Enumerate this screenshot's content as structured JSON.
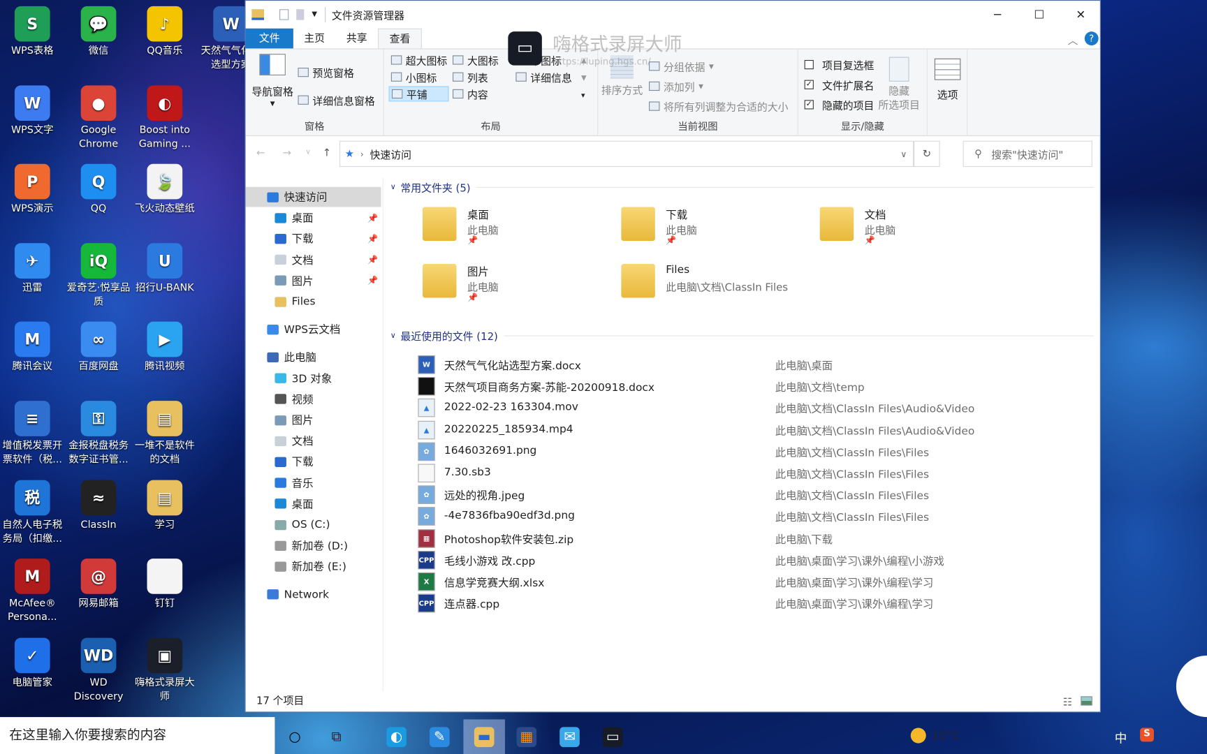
{
  "desktop": {
    "icons": [
      {
        "label": "WPS表格",
        "color": "#1e9e57",
        "glyph": "S"
      },
      {
        "label": "WPS文字",
        "color": "#3d7cf0",
        "glyph": "W"
      },
      {
        "label": "WPS演示",
        "color": "#f06a2f",
        "glyph": "P"
      },
      {
        "label": "迅雷",
        "color": "#2f8bf0",
        "glyph": "✈"
      },
      {
        "label": "腾讯会议",
        "color": "#2a7af0",
        "glyph": "M"
      },
      {
        "label": "增值税发票开票软件（税...",
        "color": "#2f6fd0",
        "glyph": "≡"
      },
      {
        "label": "自然人电子税务局（扣缴...",
        "color": "#1f74d8",
        "glyph": "税"
      },
      {
        "label": "McAfee® Persona...",
        "color": "#b01c1c",
        "glyph": "M"
      },
      {
        "label": "电脑管家",
        "color": "#1f6fe8",
        "glyph": "✓"
      },
      {
        "label": "微信",
        "color": "#2ab34a",
        "glyph": "💬"
      },
      {
        "label": "Google Chrome",
        "color": "#db4437",
        "glyph": "●"
      },
      {
        "label": "QQ",
        "color": "#1e8ef0",
        "glyph": "Q"
      },
      {
        "label": "爱奇艺·悦享品质",
        "color": "#15b83b",
        "glyph": "iQ"
      },
      {
        "label": "百度网盘",
        "color": "#3b8cf0",
        "glyph": "∞"
      },
      {
        "label": "金报税盘税务数字证书管...",
        "color": "#2a8ae0",
        "glyph": "⚿"
      },
      {
        "label": "ClassIn",
        "color": "#222222",
        "glyph": "≈"
      },
      {
        "label": "网易邮箱",
        "color": "#d23a3a",
        "glyph": "@"
      },
      {
        "label": "WD Discovery",
        "color": "#1a5fb0",
        "glyph": "WD"
      },
      {
        "label": "QQ音乐",
        "color": "#f4c400",
        "glyph": "♪"
      },
      {
        "label": "Boost into Gaming ...",
        "color": "#c01818",
        "glyph": "◐"
      },
      {
        "label": "飞火动态壁纸",
        "color": "#f3f3f3",
        "glyph": "🍃"
      },
      {
        "label": "招行U-BANK",
        "color": "#2a7ae0",
        "glyph": "U"
      },
      {
        "label": "腾讯视频",
        "color": "#2aa3f0",
        "glyph": "▶"
      },
      {
        "label": "一堆不是软件的文档",
        "color": "#e8c060",
        "glyph": "▤"
      },
      {
        "label": "学习",
        "color": "#e8c060",
        "glyph": "▤"
      },
      {
        "label": "钉钉",
        "color": "#f4f4f4",
        "glyph": " "
      },
      {
        "label": "嗨格式录屏大师",
        "color": "#1b1f2a",
        "glyph": "▣"
      },
      {
        "label": "天然气气化站选型方案",
        "color": "#2b5fb8",
        "glyph": "W"
      }
    ]
  },
  "watermark": {
    "title": "嗨格式录屏大师",
    "url": "https://luping.hgs.cn/"
  },
  "window": {
    "title": "文件资源管理器",
    "tabs": [
      "文件",
      "主页",
      "共享",
      "查看"
    ],
    "active_tab": "查看",
    "ribbon": {
      "pane": {
        "nav": "导航窗格",
        "preview": "预览窗格",
        "details": "详细信息窗格",
        "label": "窗格"
      },
      "layout": {
        "items": [
          "超大图标",
          "大图标",
          "中图标",
          "小图标",
          "列表",
          "详细信息",
          "平铺",
          "内容"
        ],
        "selected": "平铺",
        "label": "布局"
      },
      "view": {
        "sort": "排序方式",
        "group": "分组依据",
        "addcol": "添加列",
        "fit": "将所有列调整为合适的大小",
        "label": "当前视图"
      },
      "showhide": {
        "checkboxes": [
          {
            "label": "项目复选框",
            "checked": false
          },
          {
            "label": "文件扩展名",
            "checked": true
          },
          {
            "label": "隐藏的项目",
            "checked": true
          }
        ],
        "hide1": "隐藏",
        "hide2": "所选项目",
        "label": "显示/隐藏"
      },
      "options": "选项"
    },
    "address": {
      "path": "快速访问",
      "search_placeholder": "搜索\"快速访问\""
    },
    "nav": [
      {
        "label": "快速访问",
        "indent": 0,
        "color": "#2a7ae0",
        "selected": true
      },
      {
        "label": "桌面",
        "indent": 1,
        "color": "#1a8ad8",
        "pin": true
      },
      {
        "label": "下载",
        "indent": 1,
        "color": "#2a6ad0",
        "pin": true
      },
      {
        "label": "文档",
        "indent": 1,
        "color": "#c8d0da",
        "pin": true
      },
      {
        "label": "图片",
        "indent": 1,
        "color": "#7a9ab8",
        "pin": true
      },
      {
        "label": "Files",
        "indent": 1,
        "color": "#e8c060"
      },
      {
        "label": "WPS云文档",
        "indent": 0,
        "color": "#3a8ae8",
        "gap": true
      },
      {
        "label": "此电脑",
        "indent": 0,
        "color": "#3a6ab8",
        "gap": true
      },
      {
        "label": "3D 对象",
        "indent": 1,
        "color": "#3ab8e8"
      },
      {
        "label": "视频",
        "indent": 1,
        "color": "#555"
      },
      {
        "label": "图片",
        "indent": 1,
        "color": "#7a9ab8"
      },
      {
        "label": "文档",
        "indent": 1,
        "color": "#c8d0da"
      },
      {
        "label": "下载",
        "indent": 1,
        "color": "#2a6ad0"
      },
      {
        "label": "音乐",
        "indent": 1,
        "color": "#2a7ae0"
      },
      {
        "label": "桌面",
        "indent": 1,
        "color": "#1a8ad8"
      },
      {
        "label": "OS (C:)",
        "indent": 1,
        "color": "#8aa"
      },
      {
        "label": "新加卷 (D:)",
        "indent": 1,
        "color": "#999"
      },
      {
        "label": "新加卷 (E:)",
        "indent": 1,
        "color": "#999"
      },
      {
        "label": "Network",
        "indent": 0,
        "color": "#3a7ad8",
        "gap": true
      }
    ],
    "frequent": {
      "header": "常用文件夹 (5)",
      "items": [
        {
          "name": "桌面",
          "path": "此电脑",
          "pinned": true
        },
        {
          "name": "下载",
          "path": "此电脑",
          "pinned": true
        },
        {
          "name": "文档",
          "path": "此电脑",
          "pinned": true
        },
        {
          "name": "图片",
          "path": "此电脑",
          "pinned": true
        },
        {
          "name": "Files",
          "path": "此电脑\\文档\\ClassIn Files",
          "pinned": false
        }
      ]
    },
    "recent": {
      "header": "最近使用的文件 (12)",
      "items": [
        {
          "name": "天然气气化站选型方案.docx",
          "path": "此电脑\\桌面",
          "icon": "word"
        },
        {
          "name": "天然气项目商务方案-苏能-20200918.docx",
          "path": "此电脑\\文档\\temp",
          "icon": "doc-black"
        },
        {
          "name": "2022-02-23 163304.mov",
          "path": "此电脑\\文档\\ClassIn Files\\Audio&Video",
          "icon": "video"
        },
        {
          "name": "20220225_185934.mp4",
          "path": "此电脑\\文档\\ClassIn Files\\Audio&Video",
          "icon": "video"
        },
        {
          "name": "1646032691.png",
          "path": "此电脑\\文档\\ClassIn Files\\Files",
          "icon": "image"
        },
        {
          "name": "7.30.sb3",
          "path": "此电脑\\文档\\ClassIn Files\\Files",
          "icon": "blank"
        },
        {
          "name": "远处的视角.jpeg",
          "path": "此电脑\\文档\\ClassIn Files\\Files",
          "icon": "image"
        },
        {
          "name": "-4e7836fba90edf3d.png",
          "path": "此电脑\\文档\\ClassIn Files\\Files",
          "icon": "image"
        },
        {
          "name": "Photoshop软件安装包.zip",
          "path": "此电脑\\下载",
          "icon": "zip"
        },
        {
          "name": "毛线小游戏 改.cpp",
          "path": "此电脑\\桌面\\学习\\课外\\编程\\小游戏",
          "icon": "cpp"
        },
        {
          "name": "信息学竞赛大纲.xlsx",
          "path": "此电脑\\桌面\\学习\\课外\\编程\\学习",
          "icon": "excel"
        },
        {
          "name": "连点器.cpp",
          "path": "此电脑\\桌面\\学习\\课外\\编程\\学习",
          "icon": "cpp"
        }
      ]
    },
    "status": "17 个项目"
  },
  "taskbar": {
    "search_placeholder": "在这里输入你要搜索的内容",
    "weather": "10°C",
    "ime": "中",
    "apps": [
      "cortana",
      "task-view",
      "edge",
      "settings-tool",
      "file-explorer",
      "store",
      "mail",
      "screen-recorder"
    ],
    "active_app": "file-explorer"
  },
  "colors": {
    "accent": "#1979ca",
    "section": "#1e3287",
    "selected": "#cce8ff"
  }
}
